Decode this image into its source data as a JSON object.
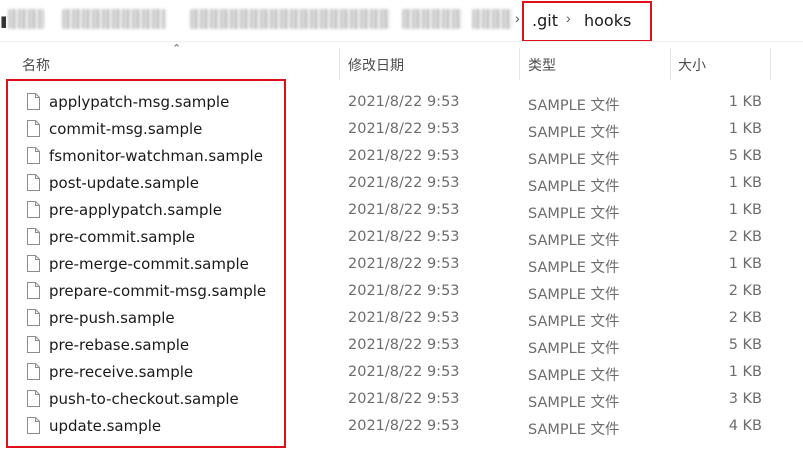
{
  "breadcrumb": {
    "items": [
      ".git",
      "hooks"
    ],
    "separator": "›"
  },
  "columns": {
    "name": "名称",
    "modified": "修改日期",
    "type": "类型",
    "size": "大小"
  },
  "files": [
    {
      "name": "applypatch-msg.sample",
      "modified": "2021/8/22 9:53",
      "type": "SAMPLE 文件",
      "size": "1 KB"
    },
    {
      "name": "commit-msg.sample",
      "modified": "2021/8/22 9:53",
      "type": "SAMPLE 文件",
      "size": "1 KB"
    },
    {
      "name": "fsmonitor-watchman.sample",
      "modified": "2021/8/22 9:53",
      "type": "SAMPLE 文件",
      "size": "5 KB"
    },
    {
      "name": "post-update.sample",
      "modified": "2021/8/22 9:53",
      "type": "SAMPLE 文件",
      "size": "1 KB"
    },
    {
      "name": "pre-applypatch.sample",
      "modified": "2021/8/22 9:53",
      "type": "SAMPLE 文件",
      "size": "1 KB"
    },
    {
      "name": "pre-commit.sample",
      "modified": "2021/8/22 9:53",
      "type": "SAMPLE 文件",
      "size": "2 KB"
    },
    {
      "name": "pre-merge-commit.sample",
      "modified": "2021/8/22 9:53",
      "type": "SAMPLE 文件",
      "size": "1 KB"
    },
    {
      "name": "prepare-commit-msg.sample",
      "modified": "2021/8/22 9:53",
      "type": "SAMPLE 文件",
      "size": "2 KB"
    },
    {
      "name": "pre-push.sample",
      "modified": "2021/8/22 9:53",
      "type": "SAMPLE 文件",
      "size": "2 KB"
    },
    {
      "name": "pre-rebase.sample",
      "modified": "2021/8/22 9:53",
      "type": "SAMPLE 文件",
      "size": "5 KB"
    },
    {
      "name": "pre-receive.sample",
      "modified": "2021/8/22 9:53",
      "type": "SAMPLE 文件",
      "size": "1 KB"
    },
    {
      "name": "push-to-checkout.sample",
      "modified": "2021/8/22 9:53",
      "type": "SAMPLE 文件",
      "size": "3 KB"
    },
    {
      "name": "update.sample",
      "modified": "2021/8/22 9:53",
      "type": "SAMPLE 文件",
      "size": "4 KB"
    }
  ],
  "colors": {
    "highlight": "#e0101a",
    "secondary_text": "#6d6d6d",
    "header_text": "#4d4d4d"
  },
  "icons": {
    "file": "file-icon",
    "sort": "sort-ascending-icon",
    "separator": "chevron-right-icon"
  }
}
